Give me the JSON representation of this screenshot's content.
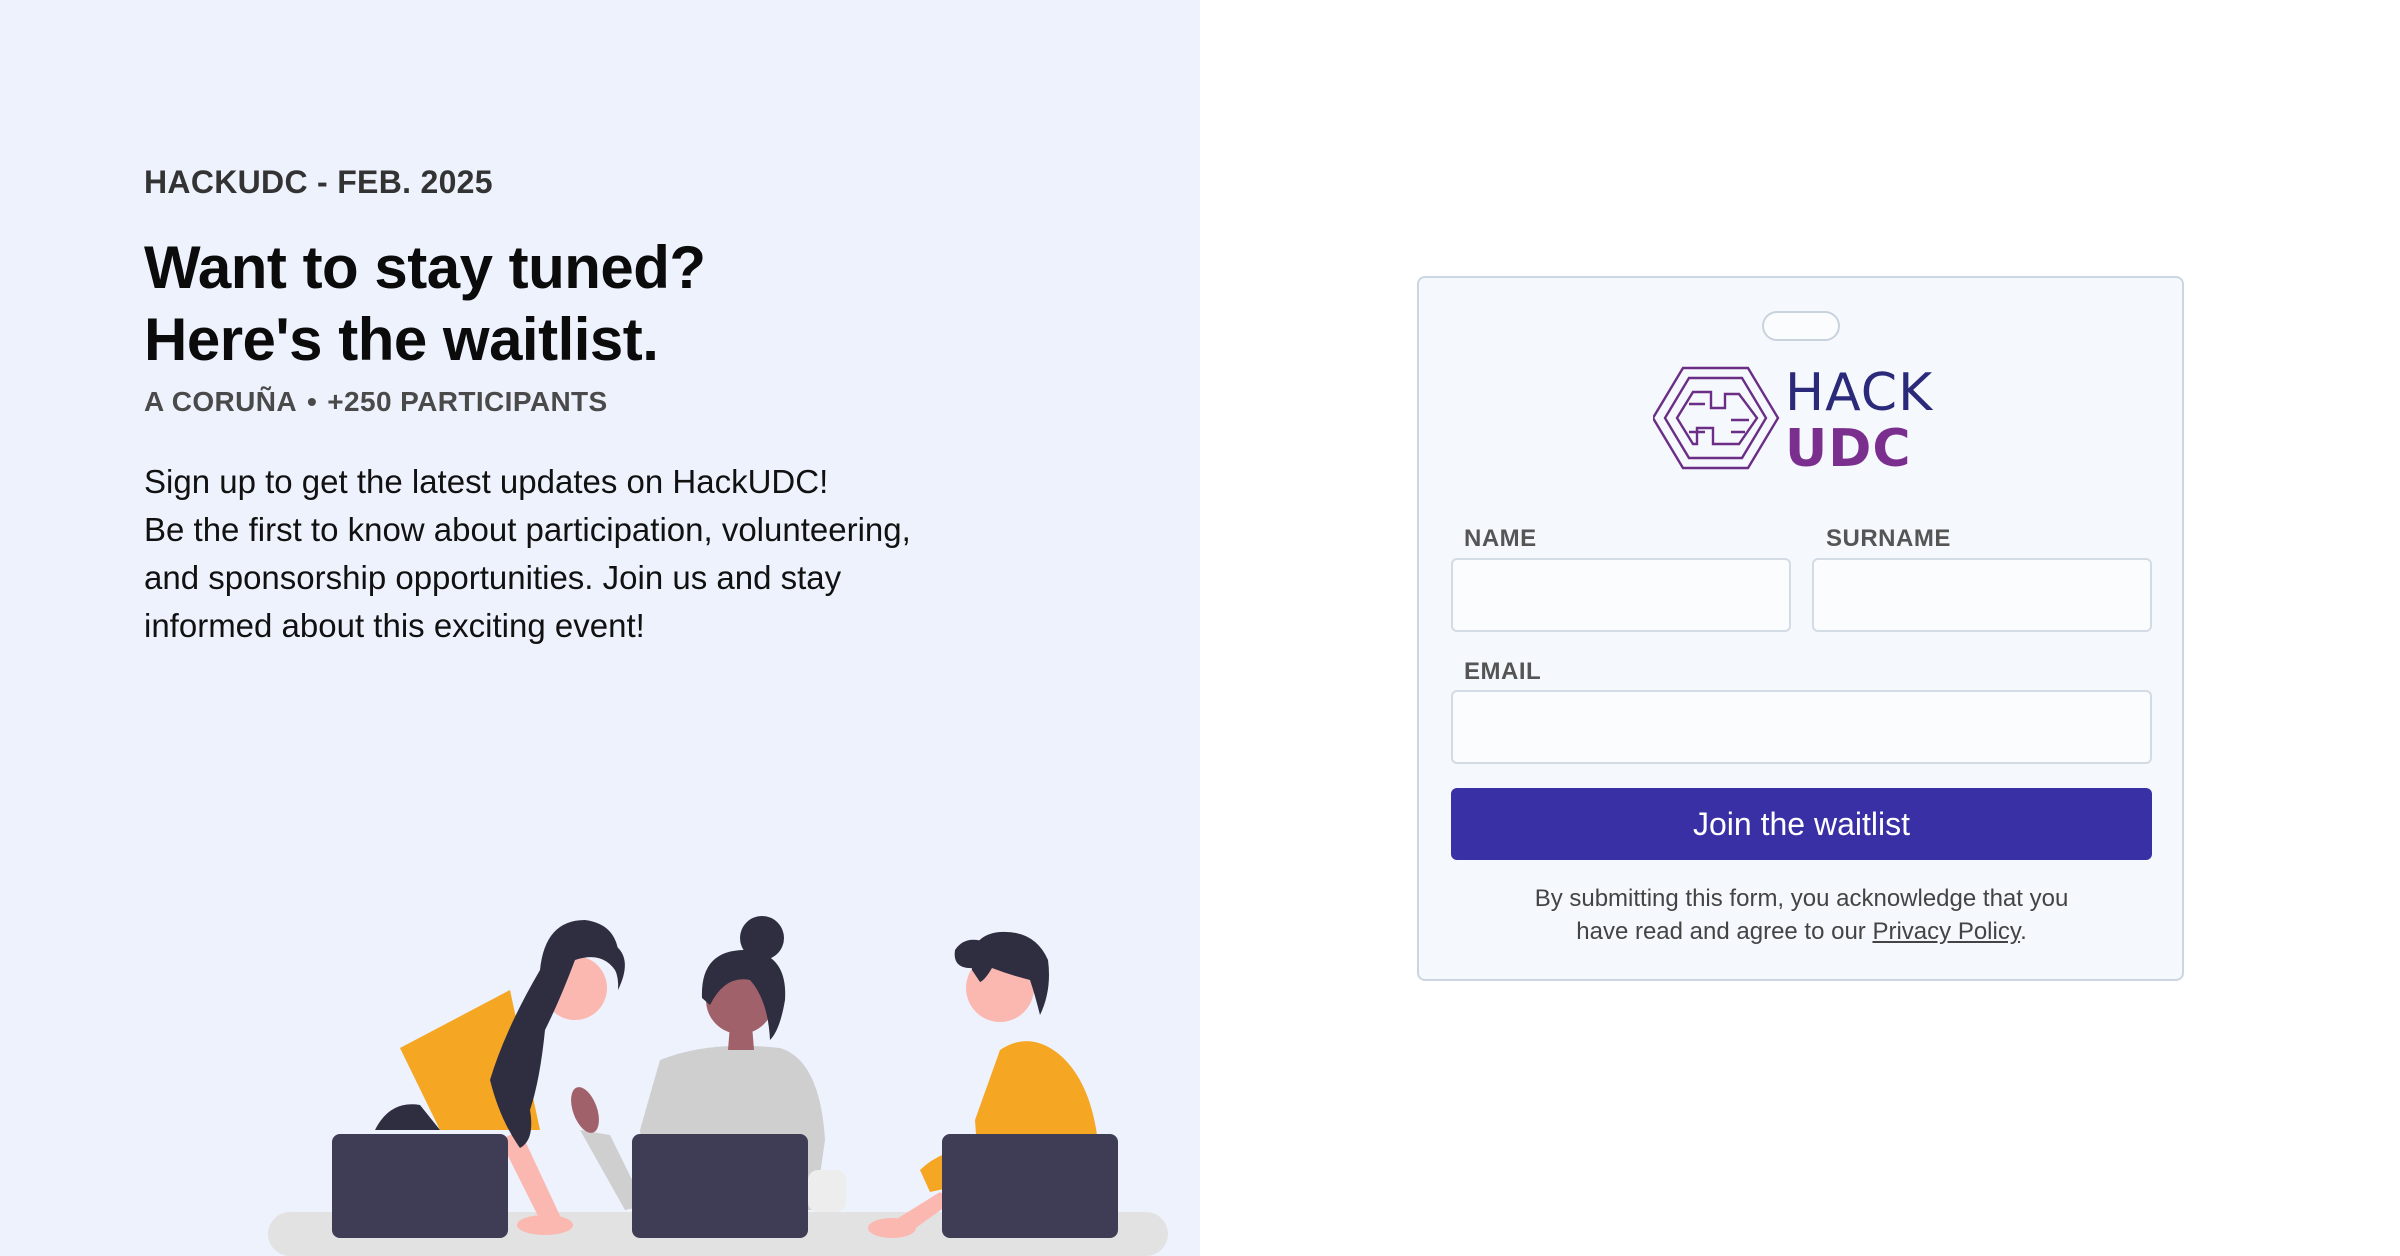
{
  "hero": {
    "eyebrow": "HACKUDC - FEB. 2025",
    "headline_line1": "Want to stay tuned?",
    "headline_line2": "Here's the waitlist.",
    "location": "A CORUÑA",
    "separator": "•",
    "participants": "+250 PARTICIPANTS",
    "description_lines": [
      "Sign up to get the latest updates on HackUDC!",
      "Be the first to know about participation, volunteering,",
      "and sponsorship opportunities. Join us and stay",
      "informed about this exciting event!"
    ]
  },
  "logo": {
    "line1": "HACK",
    "line2": "UDC",
    "icon": "circuit-hexagon-icon",
    "colors": {
      "hack": "#2b2a7a",
      "udc": "#7a2f8f"
    }
  },
  "form": {
    "name_label": "NAME",
    "name_value": "",
    "surname_label": "SURNAME",
    "surname_value": "",
    "email_label": "EMAIL",
    "email_value": "",
    "submit_label": "Join the waitlist",
    "legal_line1": "By submitting this form, you acknowledge that you",
    "legal_line2_prefix": "have read and agree to our ",
    "privacy_link": "Privacy Policy",
    "legal_suffix": "."
  },
  "colors": {
    "left_background": "#edf2fd",
    "primary_button": "#3a30a5",
    "card_background": "#f5f8fc",
    "illustration_accent": "#f5a623",
    "laptop": "#3f3d56"
  }
}
